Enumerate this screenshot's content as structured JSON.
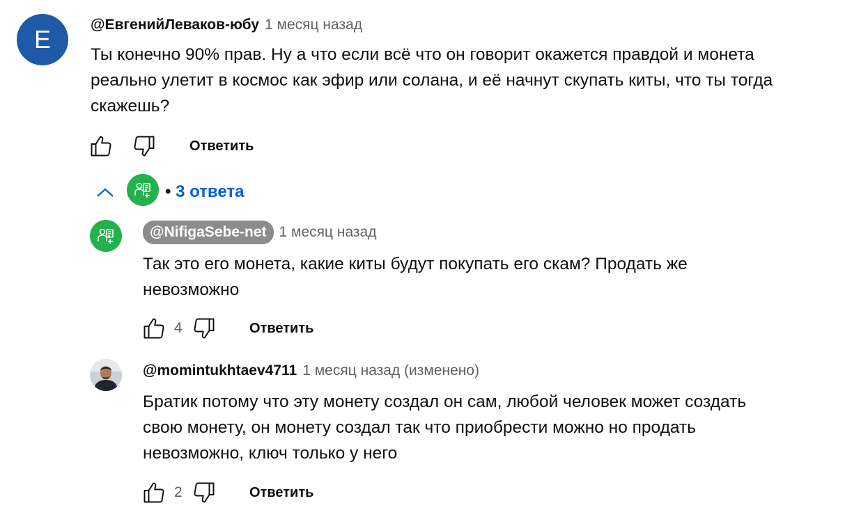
{
  "comment": {
    "avatar_letter": "E",
    "author": "@ЕвгенийЛеваков-юбу",
    "time": "1 месяц назад",
    "text_lines": [
      "Ты конечно 90% прав. Ну а что если всё что он говорит окажется правдой и монета",
      "реально улетит в космос как эфир или солана, и её начнут скупать киты, что ты тогда",
      "скажешь?"
    ],
    "reply_label": "Ответить"
  },
  "replies_toggle": {
    "bullet": "•",
    "label": "3 ответа",
    "color": "#065fd4"
  },
  "replies": [
    {
      "author": "@NifigaSebe-net",
      "time": "1 месяц назад",
      "text_lines": [
        "Так это его монета, какие киты будут покупать его скам? Продать же",
        "невозможно"
      ],
      "likes": "4",
      "reply_label": "Ответить",
      "avatar": "green-badge-icon"
    },
    {
      "author": "@momintukhtaev4711",
      "time": "1 месяц назад (изменено)",
      "text_lines": [
        "Братик потому что эту монету создал он сам, любой человек может создать",
        "свою монету, он монету создал так что приобрести можно но продать",
        "невозможно, ключ только у него"
      ],
      "likes": "2",
      "reply_label": "Ответить",
      "avatar": "user-photo"
    }
  ],
  "colors": {
    "avatar_blue": "#1e5aa8",
    "avatar_green": "#22b14c",
    "chip_gray": "#8c8c8c",
    "meta_gray": "#606060"
  }
}
